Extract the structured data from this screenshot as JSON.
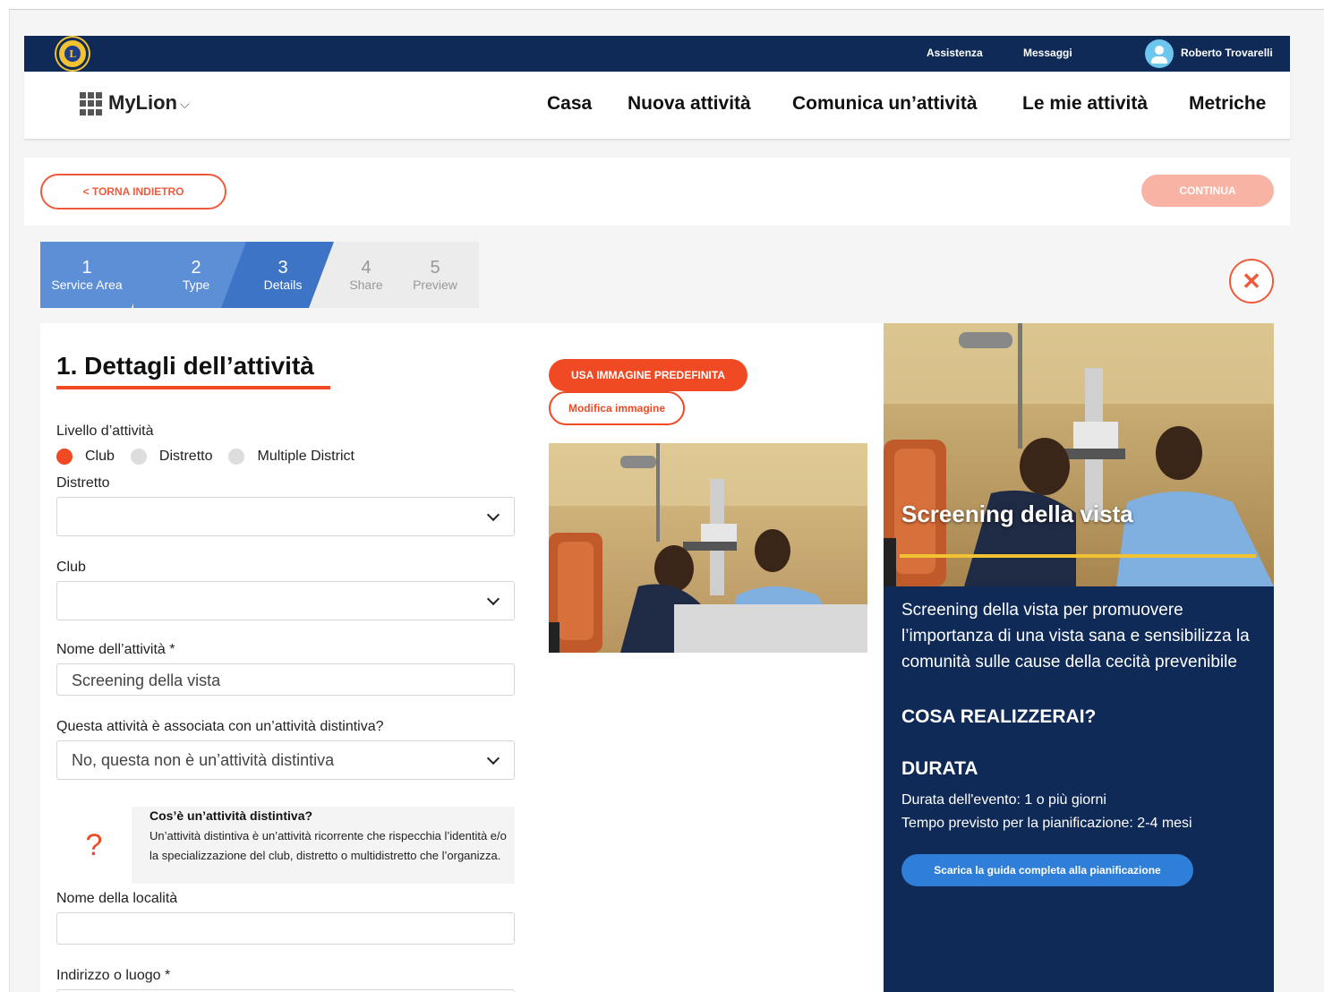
{
  "topbar": {
    "links": [
      "Assistenza",
      "Messaggi"
    ],
    "user_name": "Roberto Trovarelli",
    "logo_letter": "L"
  },
  "navbar": {
    "brand": "MyLion",
    "brand_chevron": "⌵",
    "items": [
      "Casa",
      "Nuova attività",
      "Comunica un’attività",
      "Le mie attività",
      "Metriche"
    ]
  },
  "actions": {
    "back_label": "< TORNA INDIETRO",
    "continue_label": "CONTINUA"
  },
  "stepper": {
    "steps": [
      {
        "num": "1",
        "label": "Service Area"
      },
      {
        "num": "2",
        "label": "Type"
      },
      {
        "num": "3",
        "label": "Details"
      },
      {
        "num": "4",
        "label": "Share"
      },
      {
        "num": "5",
        "label": "Preview"
      }
    ],
    "current": 3
  },
  "close_glyph": "✕",
  "form": {
    "title": "1. Dettagli dell’attività",
    "level_label": "Livello d’attività",
    "level_options": [
      "Club",
      "Distretto",
      "Multiple District"
    ],
    "level_selected": "Club",
    "district_label": "Distretto",
    "district_value": "",
    "club_label": "Club",
    "club_value": "",
    "name_label": "Nome dell’attività *",
    "name_value": "Screening della vista",
    "signature_label": "Questa attività è associata con un’attività distintiva?",
    "signature_value": "No, questa non è un’attività distintiva",
    "info_glyph": "?",
    "info_title": "Cos’è un’attività distintiva?",
    "info_text": "Un’attività distintiva è un’attività ricorrente che rispecchia l’identità e/o la specializzazione del club, distretto o multidistretto che l’organizza.",
    "location_label": "Nome della località",
    "location_value": "",
    "address_label": "Indirizzo o luogo *"
  },
  "image": {
    "default_button": "USA IMMAGINE PREDEFINITA",
    "modify_button": "Modifica immagine"
  },
  "preview": {
    "title": "Screening della vista",
    "description": "Screening della vista per promuovere l’importanza di una vista sana e sensibilizza la comunità sulle cause della cecità prevenibile",
    "heading_achieve": "COSA REALIZZERAI?",
    "heading_duration": "DURATA",
    "event_duration": "Durata dell'evento: 1 o più giorni",
    "planning_time": "Tempo previsto per la pianificazione: 2-4 mesi",
    "guide_button": "Scarica la guida completa alla pianificazione"
  },
  "colors": {
    "navy": "#0f2a57",
    "accent": "#f04a25",
    "gold": "#f1c232",
    "step_active": "#5c8fd6",
    "guide_blue": "#2f7fd8"
  }
}
